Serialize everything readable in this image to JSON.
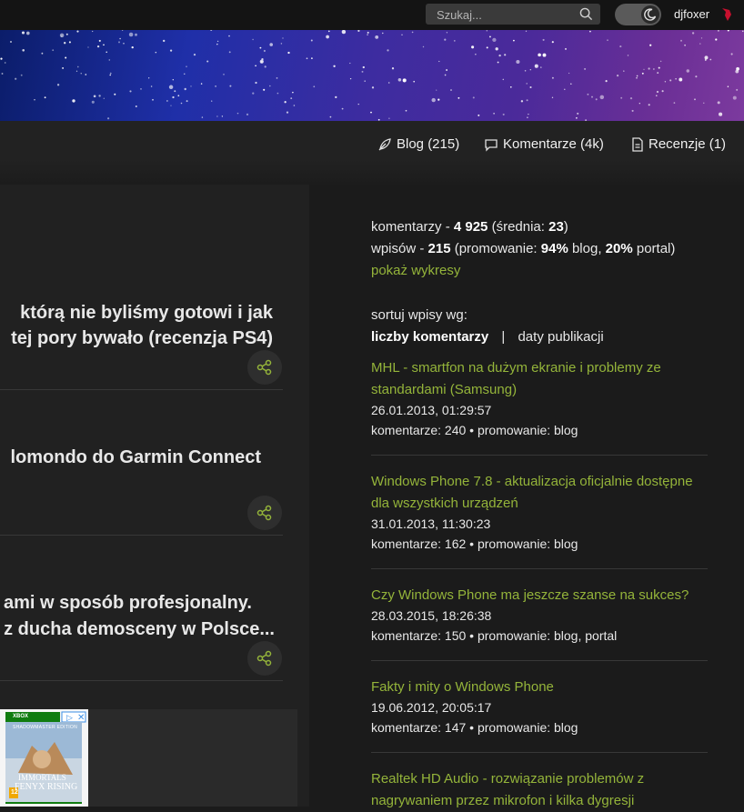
{
  "topbar": {
    "search_placeholder": "Szukaj...",
    "username": "djfoxer"
  },
  "nav": {
    "blog": "Blog (215)",
    "comments": "Komentarze (4k)",
    "reviews": "Recenzje (1)"
  },
  "posts": [
    {
      "line1": "którą nie byliśmy gotowi i jak",
      "line2": "tej pory bywało (recenzja PS4)"
    },
    {
      "line1": "lomondo do Garmin Connect",
      "line2": ""
    },
    {
      "line1": "ami w sposób profesjonalny.",
      "line2": "z ducha demosceny w Polsce..."
    }
  ],
  "stats": {
    "comments_prefix": "komentarzy - ",
    "comments_value": "4 925",
    "avg_prefix": " (średnia: ",
    "avg_value": "23",
    "avg_suffix": ")",
    "posts_prefix": "wpisów - ",
    "posts_value": "215",
    "promo_prefix": " (promowanie: ",
    "promo_blog_value": "94%",
    "promo_blog_label": " blog, ",
    "promo_portal_value": "20%",
    "promo_portal_label": " portal)",
    "charts_link": "pokaż wykresy"
  },
  "sort": {
    "label": "sortuj wpisy wg:",
    "option_active": "liczby komentarzy",
    "separator": "|",
    "option_other": "daty publikacji"
  },
  "entries": [
    {
      "title": "MHL - smartfon na dużym ekranie i problemy ze standardami (Samsung)",
      "date": "26.01.2013, 01:29:57",
      "meta": "komentarze: 240 • promowanie: blog"
    },
    {
      "title": "Windows Phone 7.8 - aktualizacja oficjalnie dostępne dla wszystkich urządzeń",
      "date": "31.01.2013, 11:30:23",
      "meta": "komentarze: 162 • promowanie: blog"
    },
    {
      "title": "Czy Windows Phone ma jeszcze szanse na sukces?",
      "date": "28.03.2015, 18:26:38",
      "meta": "komentarze: 150 • promowanie: blog, portal"
    },
    {
      "title": "Fakty i mity o Windows Phone",
      "date": "19.06.2012, 20:05:17",
      "meta": "komentarze: 147 • promowanie: blog"
    },
    {
      "title": "Realtek HD Audio - rozwiązanie problemów z nagrywaniem przez mikrofon i kilka dygresji",
      "date": "",
      "meta": ""
    }
  ],
  "ad": {
    "badge": "XBOX",
    "edition": "SHADOWMASTER EDITION",
    "game_line1": "IMMORTALS",
    "game_line2": "FENYX RISING",
    "rating": "12"
  },
  "colors": {
    "accent_green": "#94b43a",
    "background": "#1b1b1b",
    "user_badge": "#c8102e"
  }
}
